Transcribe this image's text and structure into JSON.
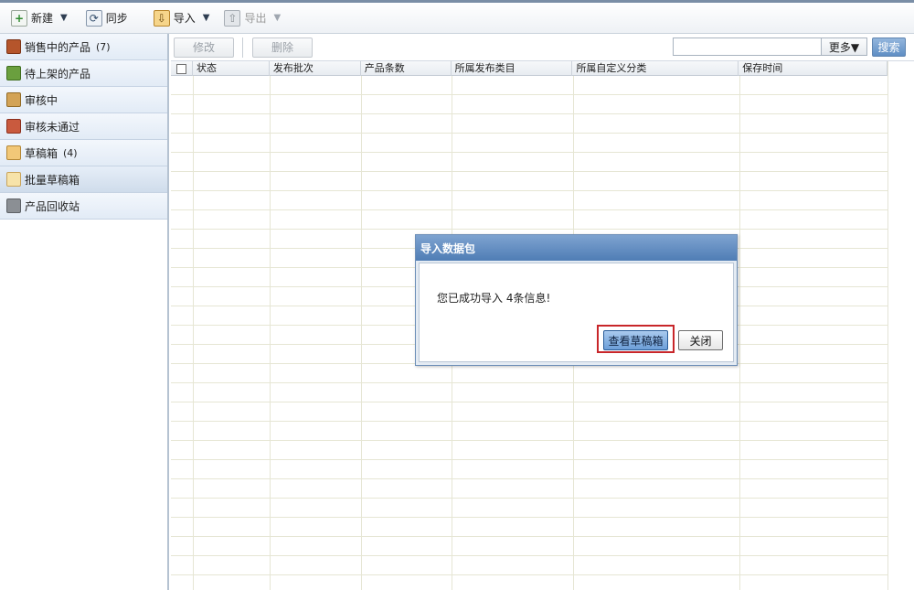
{
  "toolbar": {
    "new_label": "新建",
    "sync_label": "同步",
    "import_label": "导入",
    "export_label": "导出"
  },
  "sidebar": {
    "items": [
      {
        "label": "销售中的产品",
        "count": "(7)",
        "icon": "shop-icon"
      },
      {
        "label": "待上架的产品",
        "count": "",
        "icon": "upload-house-icon"
      },
      {
        "label": "审核中",
        "count": "",
        "icon": "review-icon"
      },
      {
        "label": "审核未通过",
        "count": "",
        "icon": "rejected-icon"
      },
      {
        "label": "草稿箱",
        "count": "(4)",
        "icon": "envelope-icon"
      },
      {
        "label": "批量草稿箱",
        "count": "",
        "icon": "folder-icon"
      },
      {
        "label": "产品回收站",
        "count": "",
        "icon": "trash-icon"
      }
    ],
    "active_index": 5
  },
  "actions": {
    "edit_label": "修改",
    "delete_label": "删除",
    "search_value": "",
    "more_label": "更多▼",
    "search_label": "搜索"
  },
  "table": {
    "columns": [
      "状态",
      "发布批次",
      "产品条数",
      "所属发布类目",
      "所属自定义分类",
      "保存时间"
    ],
    "rows": []
  },
  "dialog": {
    "title": "导入数据包",
    "message": "您已成功导入 4条信息!",
    "primary_label": "查看草稿箱",
    "close_label": "关闭"
  },
  "colors": {
    "accent": "#4f7db5",
    "highlight": "#c8262a",
    "sidebar_bg": "#e2ebf6"
  }
}
